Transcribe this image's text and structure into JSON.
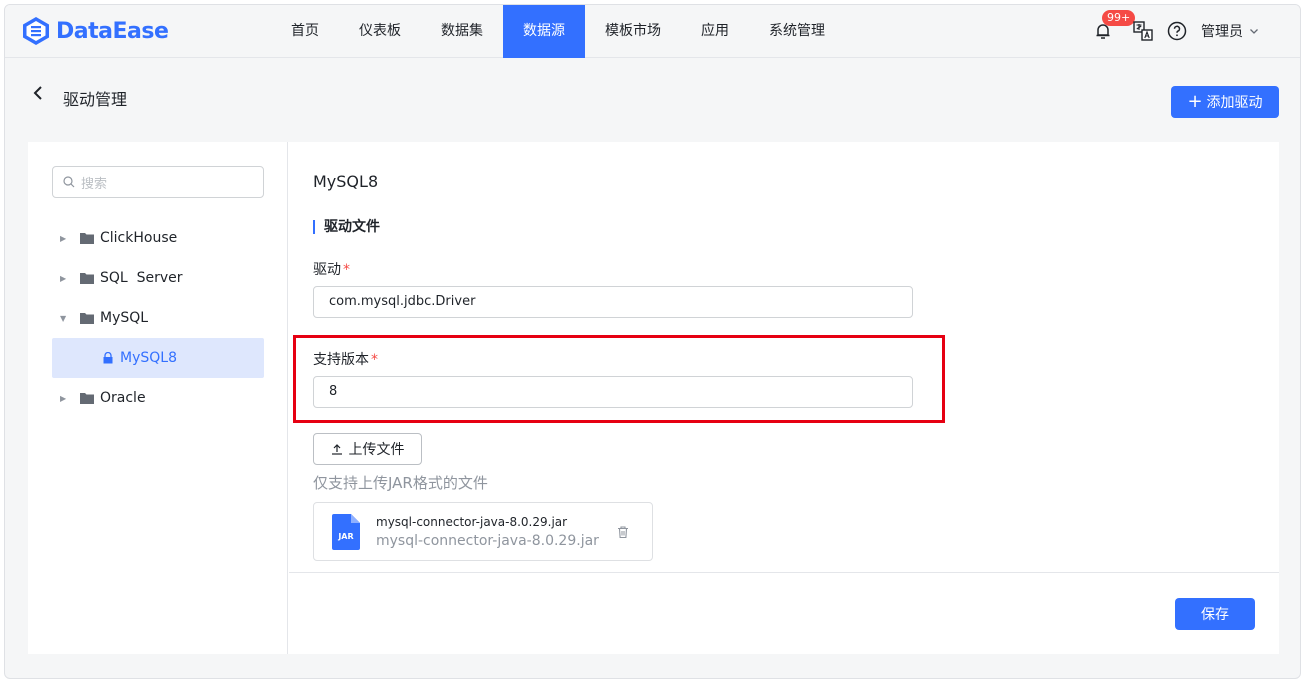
{
  "app": {
    "name": "DataEase"
  },
  "nav": {
    "items": [
      "首页",
      "仪表板",
      "数据集",
      "数据源",
      "模板市场",
      "应用",
      "系统管理"
    ],
    "active": "数据源"
  },
  "header": {
    "notification_badge": "99+",
    "user": "管理员"
  },
  "page": {
    "title": "驱动管理",
    "add_button": "添加驱动"
  },
  "sidebar": {
    "search_placeholder": "搜索",
    "tree": [
      {
        "label": "ClickHouse",
        "expanded": false
      },
      {
        "label": "SQL  Server",
        "expanded": false
      },
      {
        "label": "MySQL",
        "expanded": true
      },
      {
        "label": "MySQL8",
        "selected": true
      },
      {
        "label": "Oracle",
        "expanded": false
      }
    ]
  },
  "detail": {
    "name": "MySQL8",
    "section_title": "驱动文件",
    "driver_label": "驱动",
    "driver_value": "com.mysql.jdbc.Driver",
    "version_label": "支持版本",
    "version_value": "8",
    "required_mark": "*",
    "upload_button": "上传文件",
    "upload_tip": "仅支持上传JAR格式的文件",
    "file": {
      "icon_label": "JAR",
      "name": "mysql-connector-java-8.0.29.jar",
      "subtitle": "mysql-connector-java-8.0.29.jar"
    },
    "save_button": "保存"
  },
  "colors": {
    "primary": "#3370ff",
    "highlight_box": "#e60012",
    "required": "#f54a45"
  }
}
